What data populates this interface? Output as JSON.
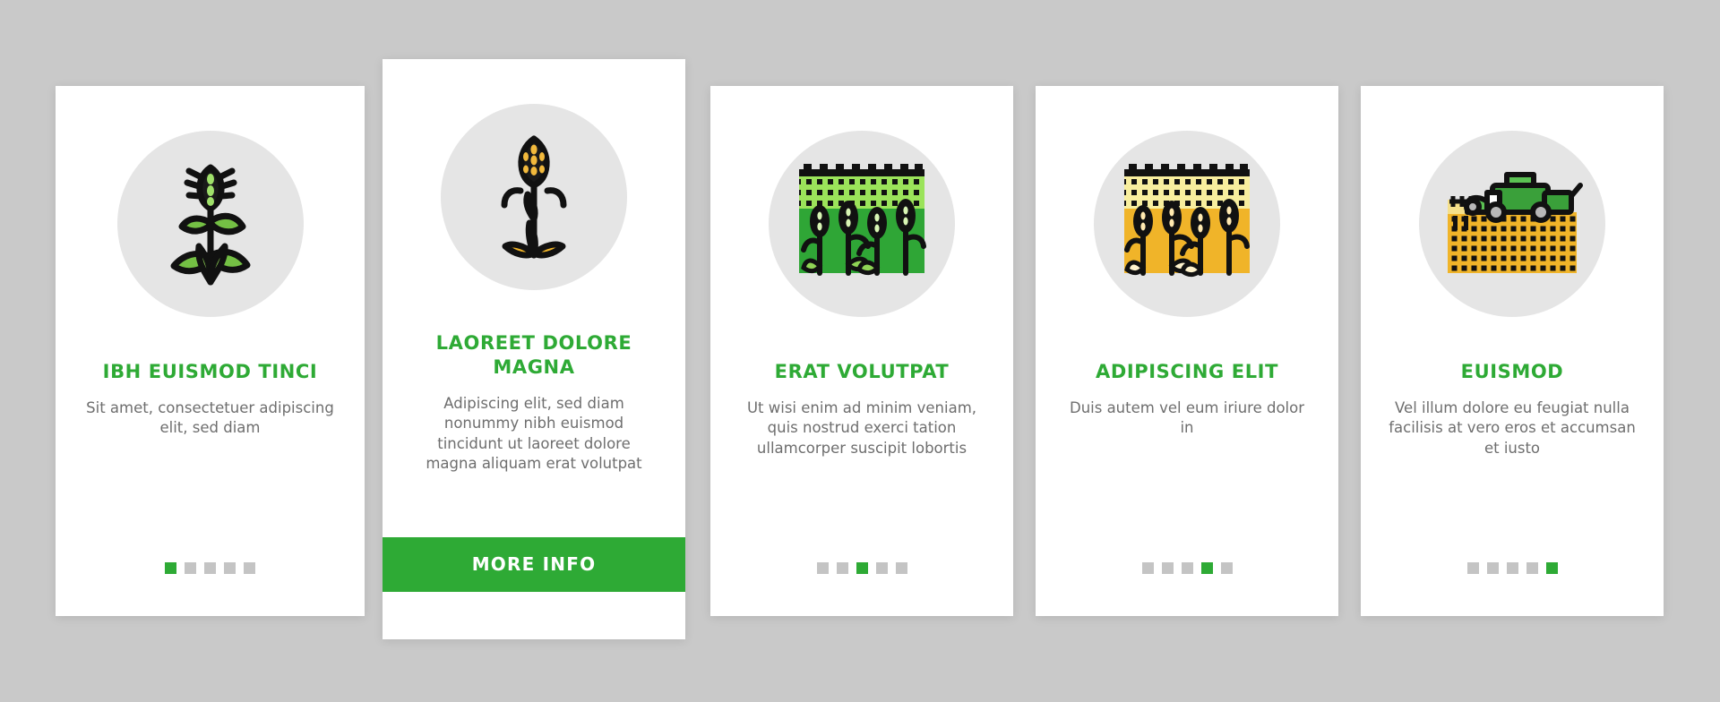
{
  "background_color": "#c9c9c9",
  "accent_color": "#2eaa35",
  "card_background": "#ffffff",
  "icon_circle_color": "#e5e5e5",
  "body_text_color": "#6e6e6e",
  "dot_inactive_color": "#c4c4c4",
  "cards": [
    {
      "icon_name": "green-wheat-stalk-icon",
      "title": "IBH EUISMOD TINCI",
      "body": "Sit amet, consectetuer adipiscing elit, sed diam",
      "dots": {
        "count": 5,
        "active_index": 0
      },
      "has_button": false,
      "button_label": ""
    },
    {
      "icon_name": "golden-wheat-stalk-icon",
      "title": "LAOREET DOLORE MAGNA",
      "body": "Adipiscing elit, sed diam nonummy nibh euismod tincidunt ut laoreet dolore magna aliquam erat volutpat",
      "dots": {
        "count": 5,
        "active_index": 1
      },
      "has_button": true,
      "button_label": "MORE INFO"
    },
    {
      "icon_name": "green-wheat-field-icon",
      "title": "ERAT VOLUTPAT",
      "body": "Ut wisi enim ad minim veniam, quis nostrud exerci tation ullamcorper suscipit lobortis",
      "dots": {
        "count": 5,
        "active_index": 2
      },
      "has_button": false,
      "button_label": ""
    },
    {
      "icon_name": "golden-wheat-field-icon",
      "title": "ADIPISCING ELIT",
      "body": "Duis autem vel eum iriure dolor in",
      "dots": {
        "count": 5,
        "active_index": 3
      },
      "has_button": false,
      "button_label": ""
    },
    {
      "icon_name": "combine-harvester-field-icon",
      "title": "EUISMOD",
      "body": "Vel illum dolore eu feugiat nulla facilisis at vero eros et accumsan et iusto",
      "dots": {
        "count": 5,
        "active_index": 4
      },
      "has_button": false,
      "button_label": ""
    }
  ]
}
